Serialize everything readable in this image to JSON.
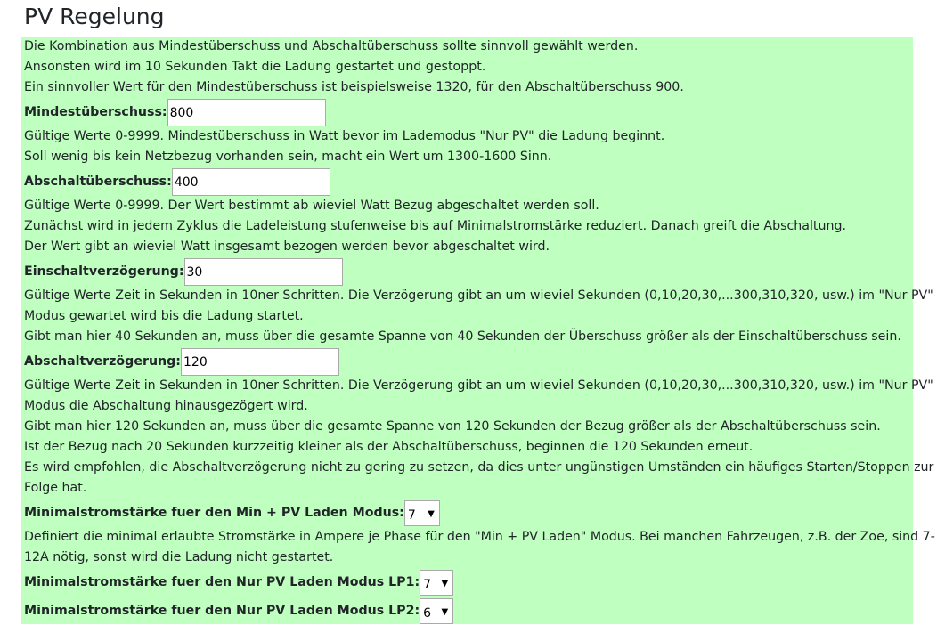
{
  "page": {
    "title": "PV Regelung"
  },
  "intro": [
    "Die Kombination aus Mindestüberschuss und Abschaltüberschuss sollte sinnvoll gewählt werden.",
    "Ansonsten wird im 10 Sekunden Takt die Ladung gestartet und gestoppt.",
    "Ein sinnvoller Wert für den Mindestüberschuss ist beispielsweise 1320, für den Abschaltüberschuss 900."
  ],
  "mindestueberschuss": {
    "label": "Mindestüberschuss:",
    "value": "800",
    "help": [
      "Gültige Werte 0-9999. Mindestüberschuss in Watt bevor im Lademodus \"Nur PV\" die Ladung beginnt.",
      "Soll wenig bis kein Netzbezug vorhanden sein, macht ein Wert um 1300-1600 Sinn."
    ]
  },
  "abschaltueberschuss": {
    "label": "Abschaltüberschuss:",
    "value": "400",
    "help": [
      "Gültige Werte 0-9999. Der Wert bestimmt ab wieviel Watt Bezug abgeschaltet werden soll.",
      "Zunächst wird in jedem Zyklus die Ladeleistung stufenweise bis auf Minimalstromstärke reduziert. Danach greift die Abschaltung.",
      "Der Wert gibt an wieviel Watt insgesamt bezogen werden bevor abgeschaltet wird."
    ]
  },
  "einschaltverzoegerung": {
    "label": "Einschaltverzögerung:",
    "value": "30",
    "help": [
      "Gültige Werte Zeit in Sekunden in 10ner Schritten. Die Verzögerung gibt an um wieviel Sekunden (0,10,20,30,...300,310,320, usw.) im \"Nur PV\"",
      "Modus gewartet wird bis die Ladung startet.",
      "Gibt man hier 40 Sekunden an, muss über die gesamte Spanne von 40 Sekunden der Überschuss größer als der Einschaltüberschuss sein."
    ]
  },
  "abschaltverzoegerung": {
    "label": "Abschaltverzögerung:",
    "value": "120",
    "help": [
      "Gültige Werte Zeit in Sekunden in 10ner Schritten. Die Verzögerung gibt an um wieviel Sekunden (0,10,20,30,...300,310,320, usw.) im \"Nur PV\"",
      "Modus die Abschaltung hinausgezögert wird.",
      "Gibt man hier 120 Sekunden an, muss über die gesamte Spanne von 120 Sekunden der Bezug größer als der Abschaltüberschuss sein.",
      "Ist der Bezug nach 20 Sekunden kurzzeitig kleiner als der Abschaltüberschuss, beginnen die 120 Sekunden erneut.",
      "Es wird empfohlen, die Abschaltverzögerung nicht zu gering zu setzen, da dies unter ungünstigen Umständen ein häufiges Starten/Stoppen zur",
      "Folge hat."
    ]
  },
  "min_pv_mode": {
    "label": "Minimalstromstärke fuer den Min + PV Laden Modus:",
    "selected": "7",
    "help": [
      "Definiert die minimal erlaubte Stromstärke in Ampere je Phase für den \"Min + PV Laden\" Modus. Bei manchen Fahrzeugen, z.B. der Zoe, sind 7-",
      "12A nötig, sonst wird die Ladung nicht gestartet."
    ]
  },
  "nurpv_lp1": {
    "label": "Minimalstromstärke fuer den Nur PV Laden Modus LP1:",
    "selected": "7"
  },
  "nurpv_lp2": {
    "label": "Minimalstromstärke fuer den Nur PV Laden Modus LP2:",
    "selected": "6"
  },
  "icons": {
    "dropdown_caret": "▼"
  }
}
